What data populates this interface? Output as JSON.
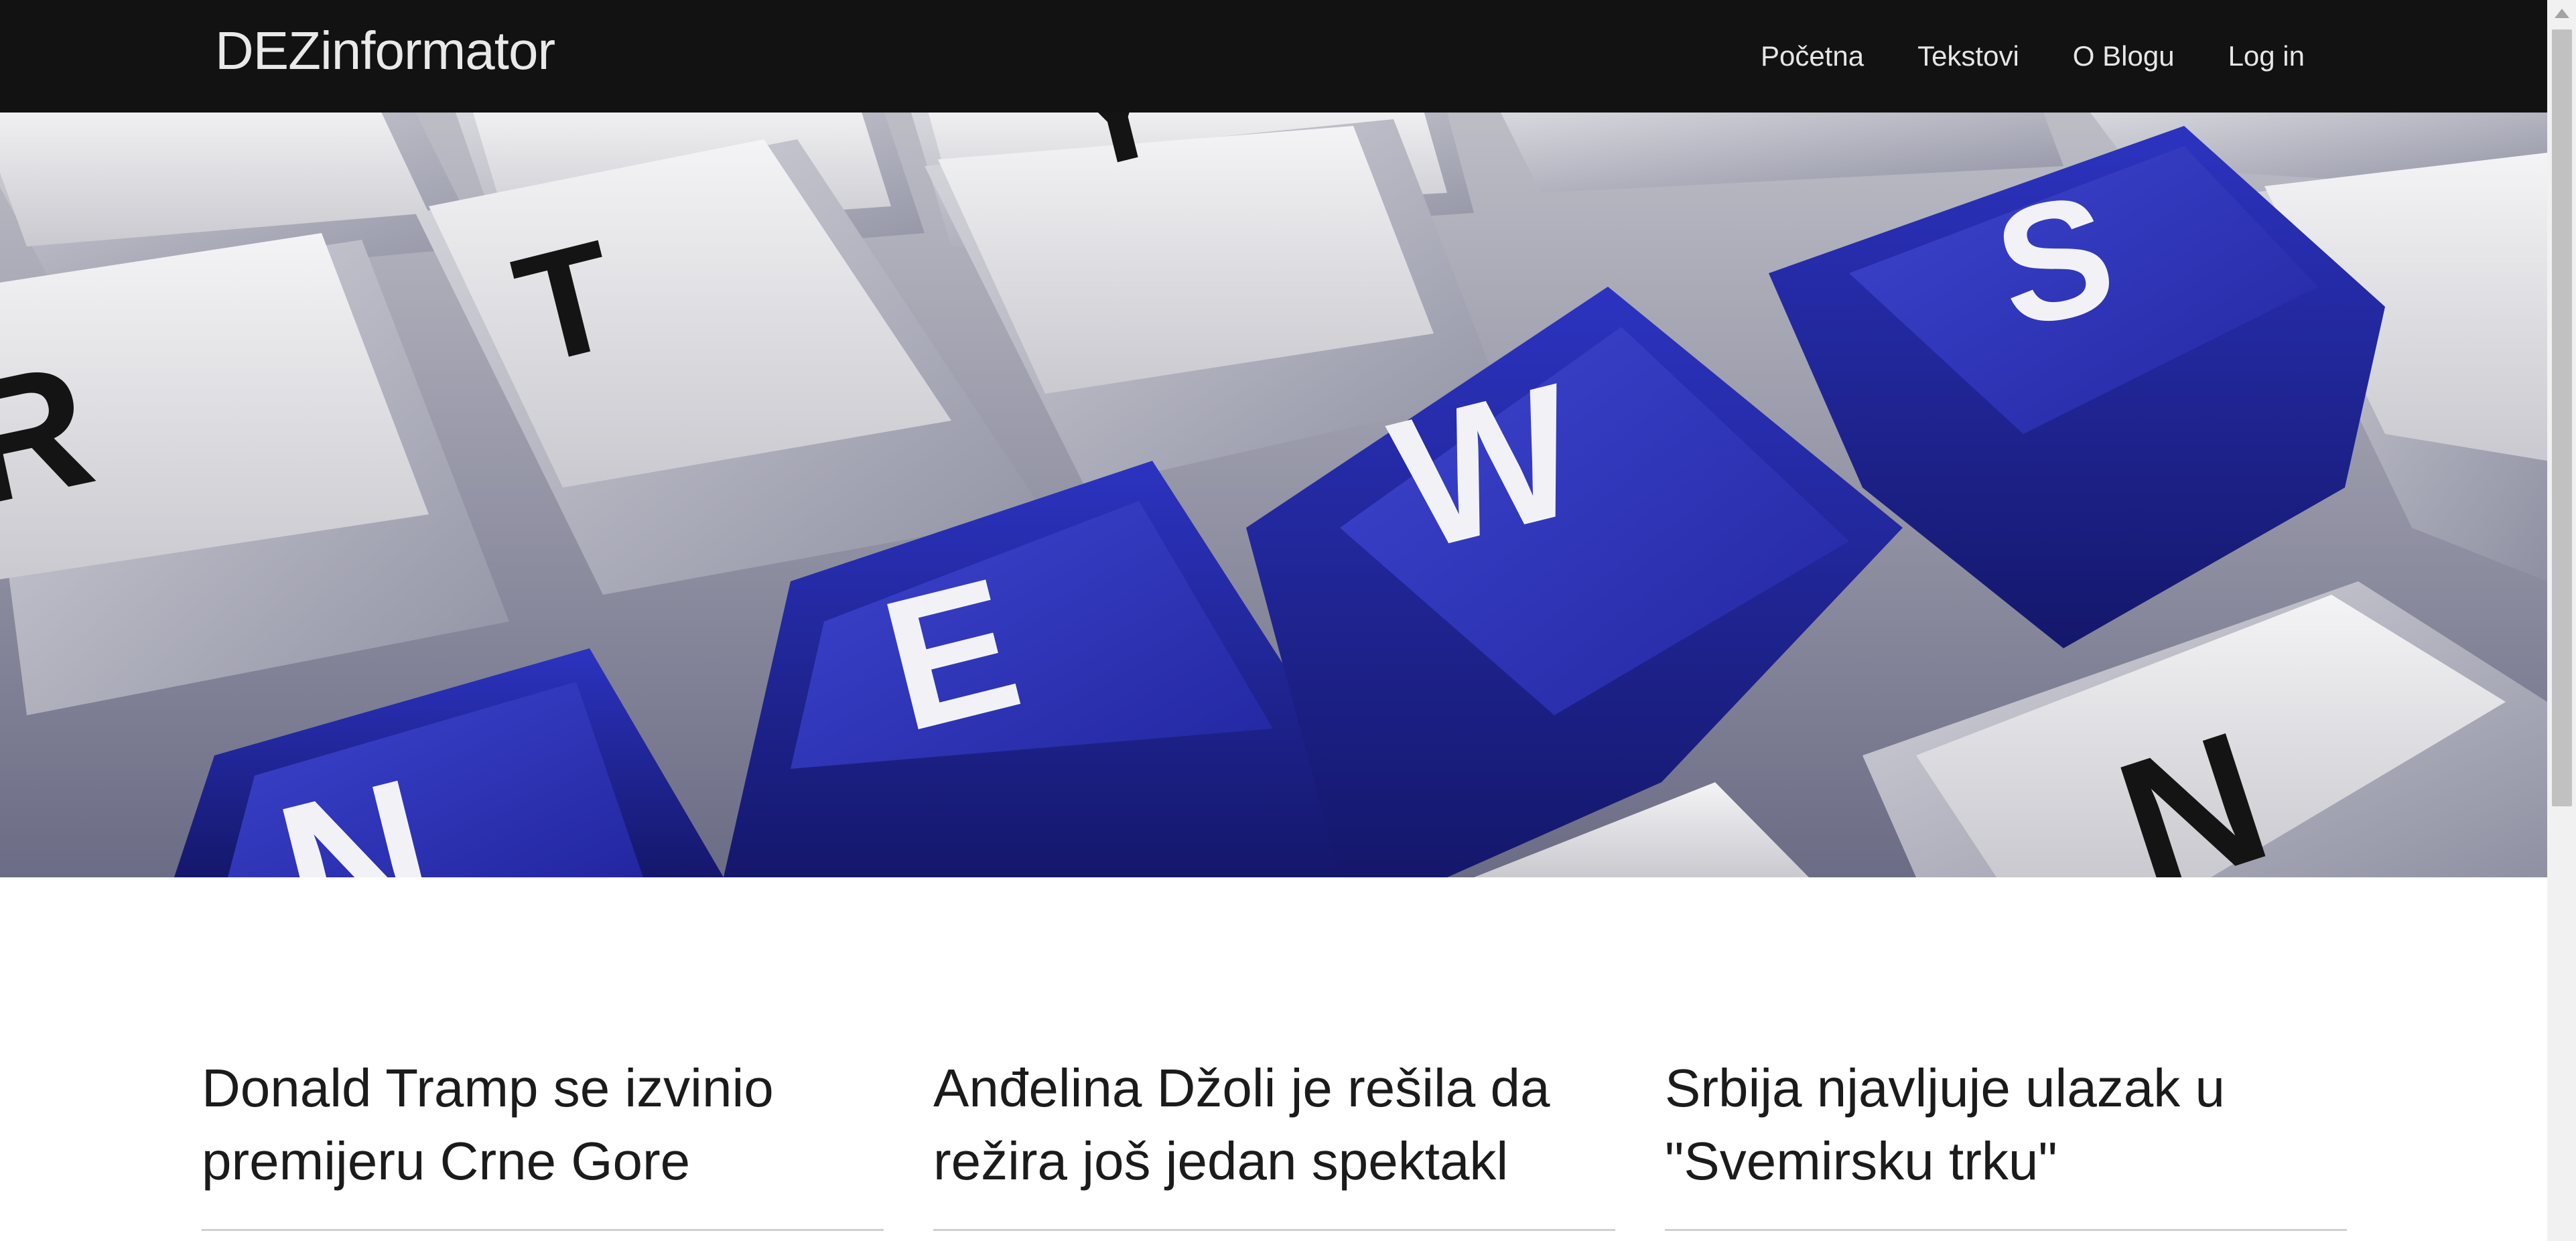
{
  "navbar": {
    "brand": "DEZinformator",
    "links": [
      {
        "label": "Početna"
      },
      {
        "label": "Tekstovi"
      },
      {
        "label": "O Blogu"
      },
      {
        "label": "Log in"
      }
    ]
  },
  "hero": {
    "keys": [
      "R",
      "T",
      "Y",
      "N",
      "E",
      "W",
      "S",
      "N"
    ]
  },
  "articles": [
    {
      "title": "Donald Tramp se izvinio premijeru Crne Gore"
    },
    {
      "title": "Anđelina Džoli je rešila da režira još jedan spektakl"
    },
    {
      "title": "Srbija njavljuje ulazak u \"Svemirsku trku\""
    }
  ],
  "colors": {
    "navbar_bg": "#121212",
    "nav_text": "#e6e6e6",
    "key_blue": "#2a2fb0",
    "key_white": "#e8e8ea"
  },
  "icons": {
    "scroll_up": "triangle-up-icon"
  }
}
